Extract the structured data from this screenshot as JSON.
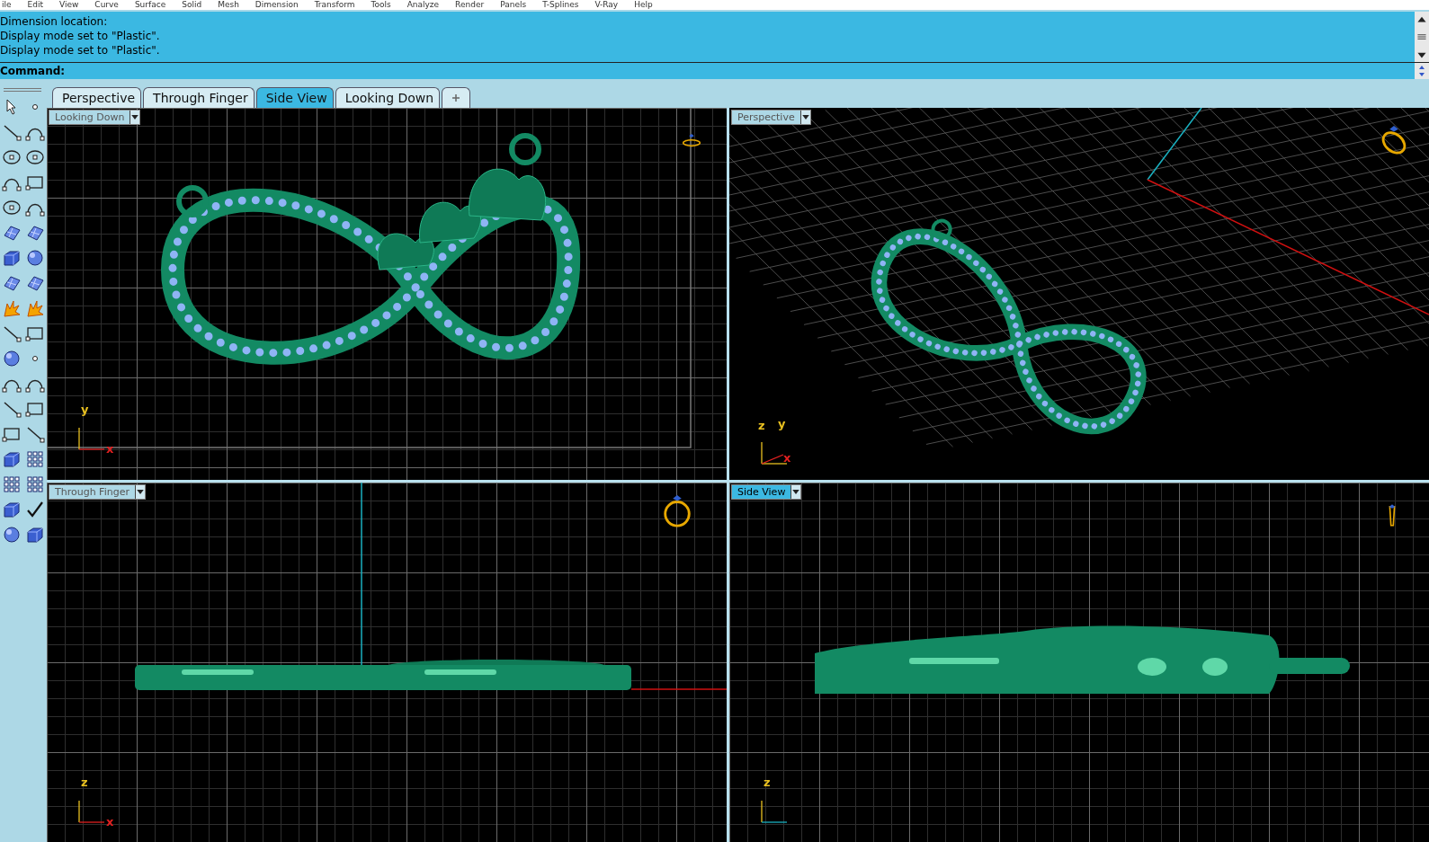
{
  "menu": [
    "ile",
    "Edit",
    "View",
    "Curve",
    "Surface",
    "Solid",
    "Mesh",
    "Dimension",
    "Transform",
    "Tools",
    "Analyze",
    "Render",
    "Panels",
    "T-Splines",
    "V-Ray",
    "Help"
  ],
  "command_history": [
    "Dimension location:",
    "Display mode set to \"Plastic\".",
    "Display mode set to \"Plastic\"."
  ],
  "command_prompt": "Command:",
  "tabs": [
    {
      "label": "Perspective",
      "selected": false
    },
    {
      "label": "Through Finger",
      "selected": false
    },
    {
      "label": "Side View",
      "selected": true
    },
    {
      "label": "Looking Down",
      "selected": false
    }
  ],
  "viewports": [
    {
      "kind": "top",
      "label": "Looking Down",
      "selected": false,
      "axes": [
        {
          "label": "y",
          "color": "#e8c020"
        },
        {
          "label": "x",
          "color": "#e02020"
        }
      ]
    },
    {
      "kind": "perspective",
      "label": "Perspective",
      "selected": false,
      "axes": [
        {
          "label": "z",
          "color": "#e8c020"
        },
        {
          "label": "y",
          "color": "#e8c020"
        },
        {
          "label": "x",
          "color": "#e02020"
        }
      ]
    },
    {
      "kind": "front",
      "label": "Through Finger",
      "selected": false,
      "axes": [
        {
          "label": "z",
          "color": "#e8c020"
        },
        {
          "label": "x",
          "color": "#e02020"
        }
      ]
    },
    {
      "kind": "right",
      "label": "Side View",
      "selected": true,
      "axes": [
        {
          "label": "z",
          "color": "#e8c020"
        }
      ]
    }
  ]
}
